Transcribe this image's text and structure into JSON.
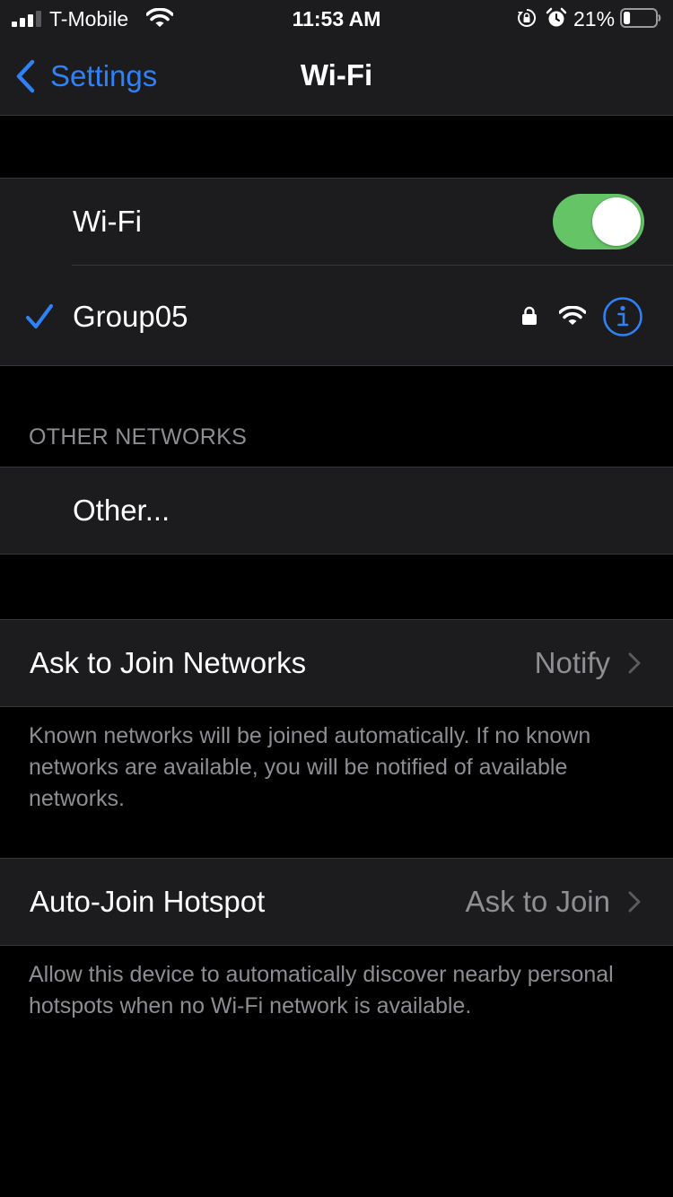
{
  "status_bar": {
    "carrier": "T-Mobile",
    "time": "11:53 AM",
    "battery_percent": "21%",
    "battery_level": 0.21,
    "icons": [
      "signal-icon",
      "wifi-icon",
      "rotation-lock-icon",
      "alarm-icon",
      "battery-icon"
    ]
  },
  "nav": {
    "back_label": "Settings",
    "title": "Wi-Fi"
  },
  "wifi_section": {
    "toggle_label": "Wi-Fi",
    "toggle_on": true,
    "connected_network": "Group05",
    "connected_icons": [
      "checkmark-icon",
      "lock-icon",
      "wifi-signal-icon",
      "info-icon"
    ]
  },
  "other_networks": {
    "header": "OTHER NETWORKS",
    "other_label": "Other..."
  },
  "ask_to_join": {
    "label": "Ask to Join Networks",
    "value": "Notify",
    "footer": "Known networks will be joined automatically. If no known networks are available, you will be notified of available networks."
  },
  "auto_join_hotspot": {
    "label": "Auto-Join Hotspot",
    "value": "Ask to Join",
    "footer": "Allow this device to automatically discover nearby personal hotspots when no Wi-Fi network is available."
  },
  "colors": {
    "accent": "#2e82f6",
    "toggle_on": "#65c466",
    "cell_background": "#1c1c1e",
    "secondary_text": "#8e8e93"
  }
}
